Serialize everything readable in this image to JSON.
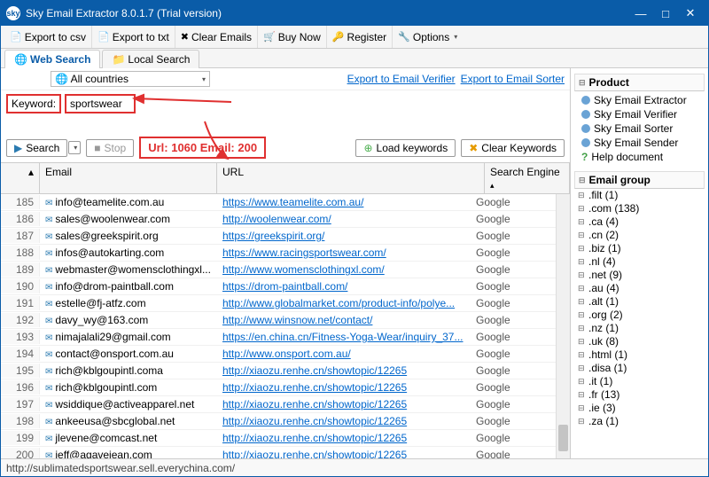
{
  "window": {
    "title": "Sky Email Extractor 8.0.1.7 (Trial version)",
    "logo_text": "sky"
  },
  "toolbar": {
    "export_csv": "Export to csv",
    "export_txt": "Export to txt",
    "clear_emails": "Clear Emails",
    "buy_now": "Buy Now",
    "register": "Register",
    "options": "Options"
  },
  "tabs": {
    "web": "Web Search",
    "local": "Local Search"
  },
  "search": {
    "country": "All countries",
    "export_verifier": "Export to Email Verifier",
    "export_sorter": "Export to Email Sorter",
    "keyword_label": "Keyword:",
    "keyword_value": "sportswear",
    "btn_search": "Search",
    "btn_stop": "Stop",
    "counter": "Url: 1060 Email: 200",
    "btn_load": "Load keywords",
    "btn_clear": "Clear Keywords"
  },
  "grid": {
    "head_email": "Email",
    "head_url": "URL",
    "head_engine": "Search Engine",
    "rows": [
      {
        "i": 185,
        "email": "info@teamelite.com.au",
        "url": "https://www.teamelite.com.au/",
        "eng": "Google"
      },
      {
        "i": 186,
        "email": "sales@woolenwear.com",
        "url": "http://woolenwear.com/",
        "eng": "Google"
      },
      {
        "i": 187,
        "email": "sales@greekspirit.org",
        "url": "https://greekspirit.org/",
        "eng": "Google"
      },
      {
        "i": 188,
        "email": "infos@autokarting.com",
        "url": "https://www.racingsportswear.com/",
        "eng": "Google"
      },
      {
        "i": 189,
        "email": "webmaster@womensclothingxl...",
        "url": "http://www.womensclothingxl.com/",
        "eng": "Google"
      },
      {
        "i": 190,
        "email": "info@drom-paintball.com",
        "url": "https://drom-paintball.com/",
        "eng": "Google"
      },
      {
        "i": 191,
        "email": "estelle@fj-atfz.com",
        "url": "http://www.globalmarket.com/product-info/polye...",
        "eng": "Google"
      },
      {
        "i": 192,
        "email": "davy_wy@163.com",
        "url": "http://www.winsnow.net/contact/",
        "eng": "Google"
      },
      {
        "i": 193,
        "email": "nimajalali29@gmail.com",
        "url": "https://en.china.cn/Fitness-Yoga-Wear/inquiry_37...",
        "eng": "Google"
      },
      {
        "i": 194,
        "email": "contact@onsport.com.au",
        "url": "http://www.onsport.com.au/",
        "eng": "Google"
      },
      {
        "i": 195,
        "email": "rich@kblgoupintl.coma",
        "url": "http://xiaozu.renhe.cn/showtopic/12265",
        "eng": "Google"
      },
      {
        "i": 196,
        "email": "rich@kblgoupintl.com",
        "url": "http://xiaozu.renhe.cn/showtopic/12265",
        "eng": "Google"
      },
      {
        "i": 197,
        "email": "wsiddique@activeapparel.net",
        "url": "http://xiaozu.renhe.cn/showtopic/12265",
        "eng": "Google"
      },
      {
        "i": 198,
        "email": "ankeeusa@sbcglobal.net",
        "url": "http://xiaozu.renhe.cn/showtopic/12265",
        "eng": "Google"
      },
      {
        "i": 199,
        "email": "jlevene@comcast.net",
        "url": "http://xiaozu.renhe.cn/showtopic/12265",
        "eng": "Google"
      },
      {
        "i": 200,
        "email": "jeff@agavejean.com",
        "url": "http://xiaozu.renhe.cn/showtopic/12265",
        "eng": "Google"
      }
    ]
  },
  "side": {
    "product_hd": "Product",
    "products": [
      "Sky Email Extractor",
      "Sky Email Verifier",
      "Sky Email Sorter",
      "Sky Email Sender"
    ],
    "help": "Help document",
    "group_hd": "Email group",
    "groups": [
      {
        "label": ".filt",
        "count": 1
      },
      {
        "label": ".com",
        "count": 138
      },
      {
        "label": ".ca",
        "count": 4
      },
      {
        "label": ".cn",
        "count": 2
      },
      {
        "label": ".biz",
        "count": 1
      },
      {
        "label": ".nl",
        "count": 4
      },
      {
        "label": ".net",
        "count": 9
      },
      {
        "label": ".au",
        "count": 4
      },
      {
        "label": ".alt",
        "count": 1
      },
      {
        "label": ".org",
        "count": 2
      },
      {
        "label": ".nz",
        "count": 1
      },
      {
        "label": ".uk",
        "count": 8
      },
      {
        "label": ".html",
        "count": 1
      },
      {
        "label": ".disa",
        "count": 1
      },
      {
        "label": ".it",
        "count": 1
      },
      {
        "label": ".fr",
        "count": 13
      },
      {
        "label": ".ie",
        "count": 3
      },
      {
        "label": ".za",
        "count": 1
      }
    ]
  },
  "status": {
    "text": "http://sublimatedsportswear.sell.everychina.com/"
  }
}
